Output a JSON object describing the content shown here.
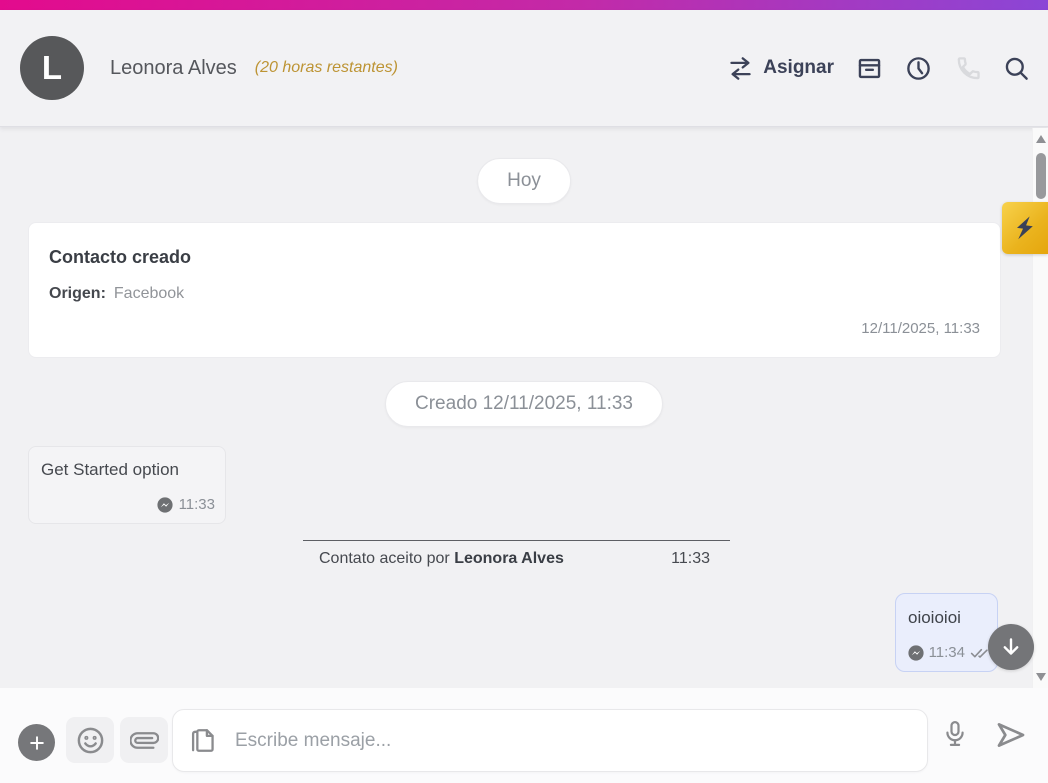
{
  "header": {
    "avatar_initial": "L",
    "contact_name": "Leonora Alves",
    "time_remaining": "(20 horas restantes)",
    "assign_label": "Asignar"
  },
  "chat": {
    "day_separator": "Hoy",
    "log_card": {
      "title": "Contacto creado",
      "origin_label": "Origen:",
      "origin_value": "Facebook",
      "timestamp": "12/11/2025, 11:33"
    },
    "created_separator": "Creado 12/11/2025, 11:33",
    "incoming_message": {
      "text": "Get Started option",
      "time": "11:33",
      "channel": "messenger"
    },
    "accepted_event": {
      "text_prefix": "Contato aceito por",
      "agent_name": "Leonora Alves",
      "time": "11:33"
    },
    "outgoing_message": {
      "text": "oioioioi",
      "time": "11:34",
      "channel": "messenger",
      "status": "delivered"
    }
  },
  "composer": {
    "placeholder": "Escribe mensaje..."
  },
  "icons": {
    "assign": "transfer-arrows",
    "archive": "archive-box",
    "schedule": "clock",
    "call": "phone",
    "search": "magnifier",
    "channel_badge": "messenger-bolt",
    "delivered": "double-check",
    "scroll_down": "down-arrow",
    "quick_actions": "lightning-bolt",
    "add": "plus",
    "emoji": "smiley-face",
    "attach": "paperclip",
    "templates": "pages",
    "voice": "microphone",
    "send": "paper-plane"
  },
  "colors": {
    "gradient_start": "#e30b8d",
    "gradient_end": "#8b46d6",
    "accent_navy": "#3c4258",
    "time_remaining_gold": "#bd9434",
    "quick_action_gold": "#eab31d",
    "outgoing_bubble_bg": "#eaeefc",
    "outgoing_bubble_border": "#c7d2f4",
    "incoming_bubble_bg": "#f4f4f6",
    "avatar_bg": "#57585a"
  }
}
